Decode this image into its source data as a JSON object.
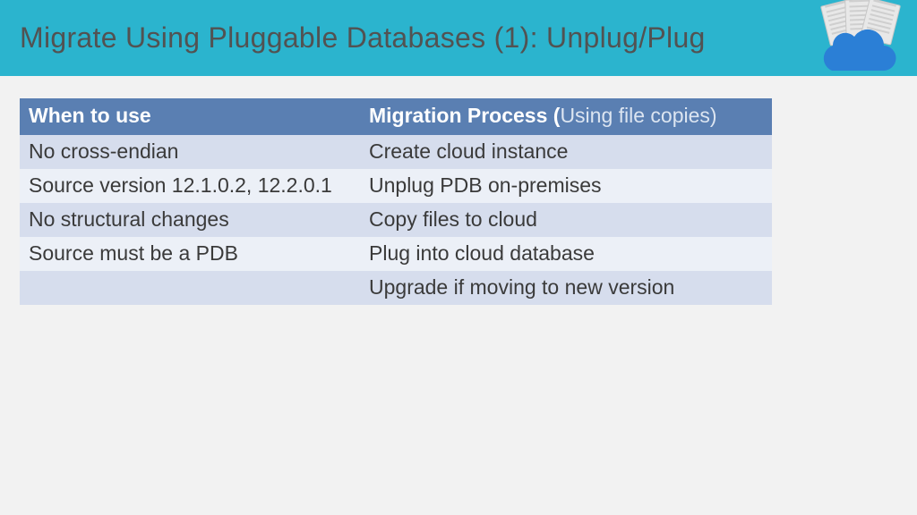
{
  "header": {
    "title": "Migrate Using Pluggable Databases (1): Unplug/Plug"
  },
  "table": {
    "headers": {
      "left": "When to use",
      "right_bold": "Migration Process (",
      "right_normal": "Using file copies)"
    },
    "rows": [
      {
        "left": "No cross-endian",
        "right": "Create cloud instance"
      },
      {
        "left": "Source version 12.1.0.2, 12.2.0.1",
        "right": "Unplug PDB on-premises"
      },
      {
        "left": "No structural changes",
        "right": "Copy files to cloud"
      },
      {
        "left": "Source must be a PDB",
        "right": "Plug into cloud database"
      },
      {
        "left": "",
        "right": "Upgrade if moving to new version"
      }
    ]
  }
}
